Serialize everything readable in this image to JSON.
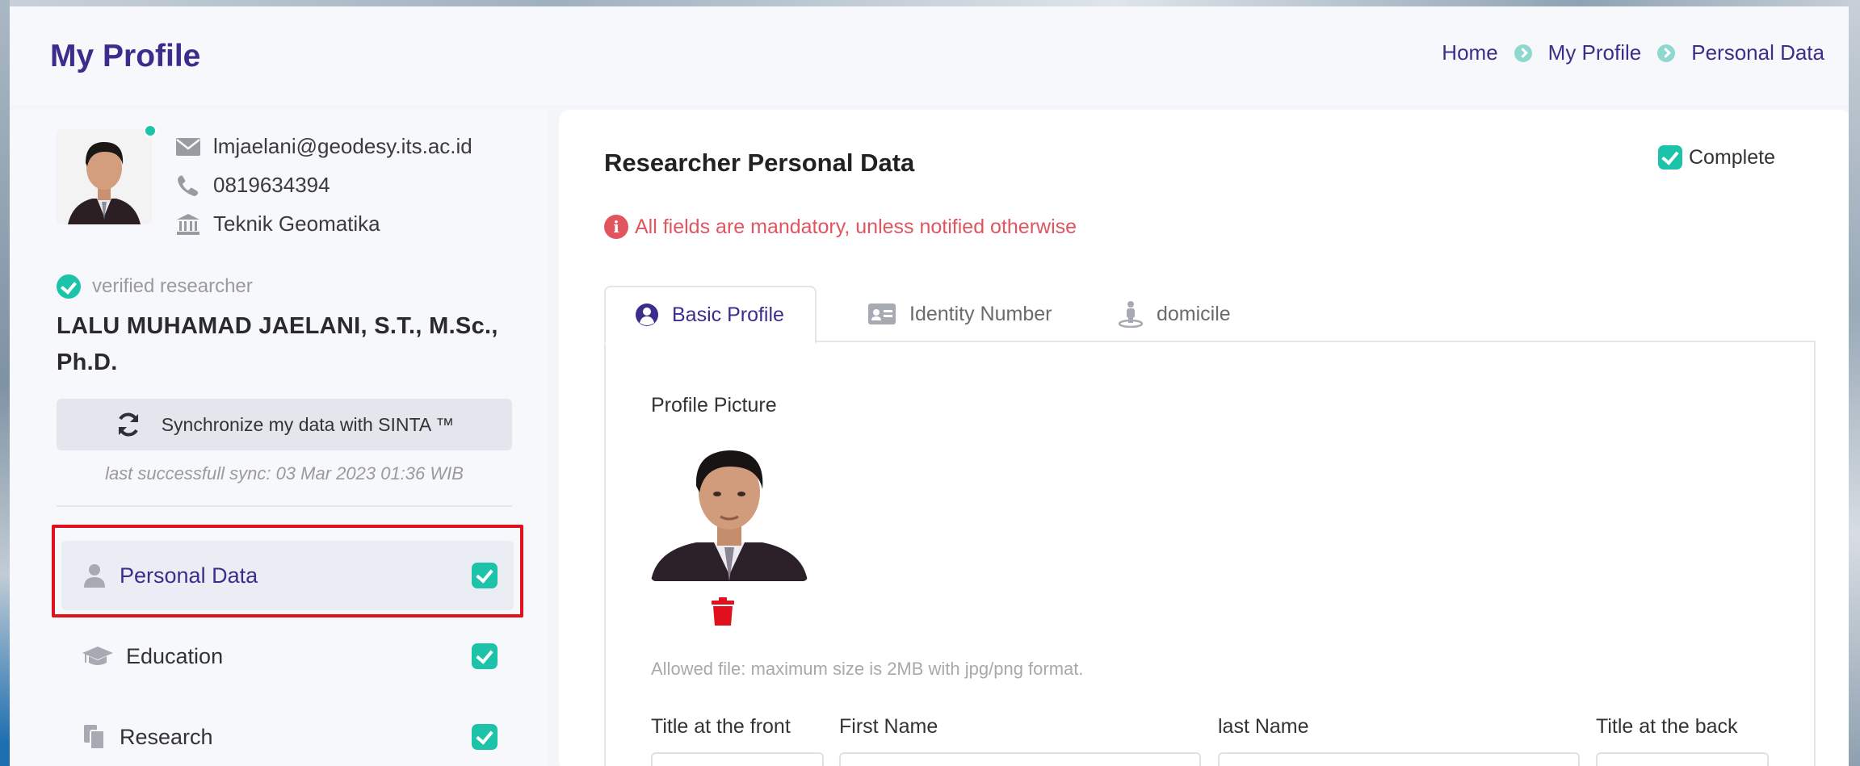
{
  "header": {
    "title": "My Profile",
    "breadcrumb": [
      "Home",
      "My Profile",
      "Personal Data"
    ]
  },
  "profile": {
    "email": "lmjaelani@geodesy.its.ac.id",
    "phone": "0819634394",
    "department": "Teknik Geomatika",
    "verified_label": "verified researcher",
    "name": "LALU MUHAMAD JAELANI, S.T., M.Sc., Ph.D.",
    "sync_button": "Synchronize my data with SINTA ™",
    "sync_note": "last successfull sync: 03 Mar 2023 01:36 WIB"
  },
  "nav": {
    "items": [
      {
        "label": "Personal Data",
        "icon": "user-icon",
        "complete": true,
        "active": true
      },
      {
        "label": "Education",
        "icon": "graduation-cap-icon",
        "complete": true,
        "active": false
      },
      {
        "label": "Research",
        "icon": "documents-icon",
        "complete": true,
        "active": false
      }
    ]
  },
  "card": {
    "title": "Researcher Personal Data",
    "status": "Complete",
    "mandatory_note": "All fields are mandatory, unless notified otherwise",
    "tabs": [
      {
        "label": "Basic Profile",
        "icon": "user-circle-icon",
        "active": true
      },
      {
        "label": "Identity Number",
        "icon": "id-card-icon",
        "active": false
      },
      {
        "label": "domicile",
        "icon": "street-view-icon",
        "active": false
      }
    ],
    "profile_picture_label": "Profile Picture",
    "allowed_file_note": "Allowed file: maximum size is 2MB with jpg/png format.",
    "fields": {
      "title_front": "Title at the front",
      "first_name": "First Name",
      "last_name": "last Name",
      "title_back": "Title at the back"
    }
  },
  "colors": {
    "brand": "#3c2d8c",
    "accent": "#1cc3a9",
    "alert": "#e0555f",
    "delete": "#e0101c"
  }
}
